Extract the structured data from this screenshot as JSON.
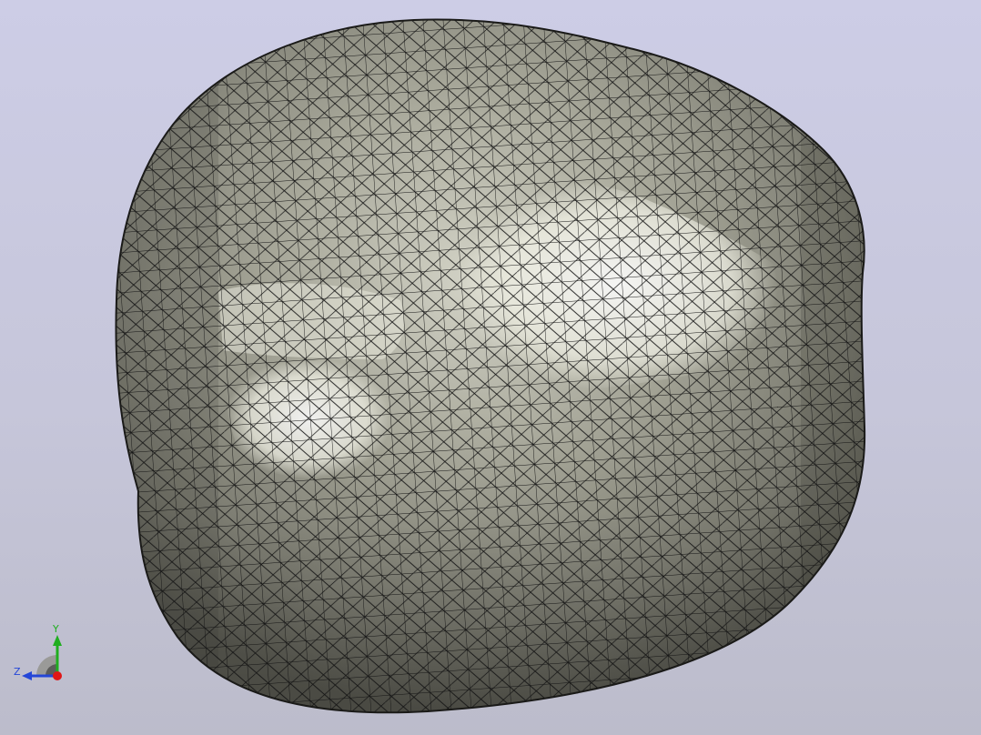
{
  "viewport": {
    "background_top": "#cdcde6",
    "background_bottom": "#bcbccb"
  },
  "model": {
    "display_mode": "shaded-with-mesh-edges",
    "surface_color": "#8e8e82",
    "highlight_color": "#fbfbf1",
    "edge_color": "#111111"
  },
  "triad": {
    "y_label": "Y",
    "z_label": "Z",
    "y_color": "#1fae1f",
    "z_color": "#2446d8",
    "x_color": "#e01616"
  }
}
